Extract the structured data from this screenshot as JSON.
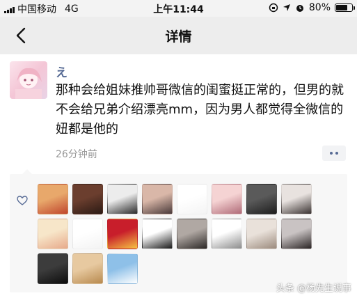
{
  "status_bar": {
    "carrier": "中国移动",
    "network": "4G",
    "time": "上午11:44",
    "battery_percent": "80%",
    "battery_level": 0.8
  },
  "navbar": {
    "title": "详情"
  },
  "post": {
    "username": "え",
    "content": "那种会给姐妹推帅哥微信的闺蜜挺正常的，但男的就不会给兄弟介绍漂亮mm，因为男人都觉得全微信的妞都是他的",
    "timestamp": "26分钟前"
  },
  "likes": {
    "avatars": [
      {
        "name": "liker-avatar-1",
        "colors": [
          "#e8a86b",
          "#c0462d"
        ]
      },
      {
        "name": "liker-avatar-2",
        "colors": [
          "#6b3e2e",
          "#2b1a14"
        ]
      },
      {
        "name": "liker-avatar-3",
        "colors": [
          "#ececec",
          "#2a2a2a"
        ]
      },
      {
        "name": "liker-avatar-4",
        "colors": [
          "#d9b7a8",
          "#4a3a3a"
        ]
      },
      {
        "name": "liker-avatar-5",
        "colors": [
          "#ffffff",
          "#f4f4f4"
        ]
      },
      {
        "name": "liker-avatar-6",
        "colors": [
          "#f5d3d3",
          "#b06b78"
        ]
      },
      {
        "name": "liker-avatar-7",
        "colors": [
          "#5a5a5a",
          "#1e1e1e"
        ]
      },
      {
        "name": "liker-avatar-8",
        "colors": [
          "#e8e2df",
          "#3a3332"
        ]
      },
      {
        "name": "liker-avatar-9",
        "colors": [
          "#f7e6c9",
          "#e7a98a"
        ]
      },
      {
        "name": "liker-avatar-10",
        "colors": [
          "#ffffff",
          "#f3f3f3"
        ]
      },
      {
        "name": "liker-avatar-11",
        "colors": [
          "#c81e2b",
          "#f6c343"
        ]
      },
      {
        "name": "liker-avatar-12",
        "colors": [
          "#ffffff",
          "#1a1a1a"
        ]
      },
      {
        "name": "liker-avatar-13",
        "colors": [
          "#b0a8a3",
          "#2c2826"
        ]
      },
      {
        "name": "liker-avatar-14",
        "colors": [
          "#ffffff",
          "#8c8c8c"
        ]
      },
      {
        "name": "liker-avatar-15",
        "colors": [
          "#e9e1da",
          "#9b8a7d"
        ]
      },
      {
        "name": "liker-avatar-16",
        "colors": [
          "#c9c3c3",
          "#2a2424"
        ]
      },
      {
        "name": "liker-avatar-17",
        "colors": [
          "#3c3c3c",
          "#0d0d0d"
        ]
      },
      {
        "name": "liker-avatar-18",
        "colors": [
          "#e7c9a0",
          "#b88a4f"
        ]
      },
      {
        "name": "liker-avatar-19",
        "colors": [
          "#8ec0e8",
          "#ffffff"
        ]
      }
    ]
  },
  "watermark": "头条 @杨先生说事",
  "icons": {
    "back": "chevron-left-icon",
    "like": "heart-icon",
    "more": "more-dots-icon",
    "location": "location-arrow-icon",
    "alarm": "alarm-icon",
    "rotation_lock": "rotation-lock-icon"
  },
  "colors": {
    "username": "#576b95",
    "nav_background": "#ededed",
    "likes_background": "#f7f7f7"
  }
}
